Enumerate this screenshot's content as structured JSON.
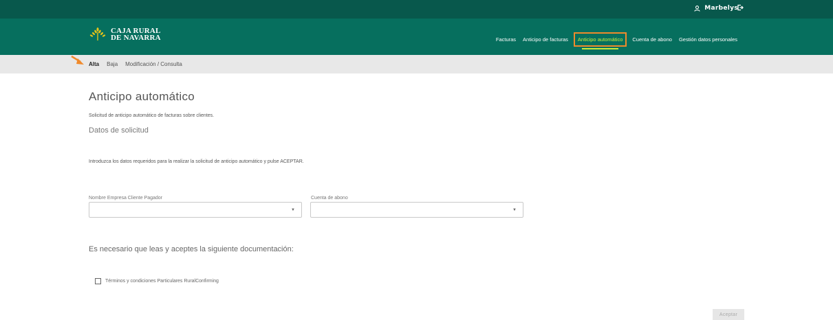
{
  "header": {
    "user_name": "Marbelys",
    "logo_line1": "CAJA RURAL",
    "logo_line2": "DE NAVARRA"
  },
  "nav": {
    "items": [
      {
        "label": "Facturas"
      },
      {
        "label": "Anticipo de facturas"
      },
      {
        "label": "Anticipo automático",
        "active": true
      },
      {
        "label": "Cuenta de abono"
      },
      {
        "label": "Gestión datos personales"
      }
    ]
  },
  "subnav": {
    "items": [
      {
        "label": "Alta",
        "active": true
      },
      {
        "label": "Baja"
      },
      {
        "label": "Modificación / Consulta"
      }
    ]
  },
  "page": {
    "title": "Anticipo automático",
    "intro": "Solicitud de anticipo automático de facturas sobre clientes.",
    "section_title": "Datos de solicitud",
    "instructions": "Introduzca los datos requeridos para la realizar la solicitud de anticipo automático y pulse ACEPTAR."
  },
  "form": {
    "company_label": "Nombre Empresa Cliente Pagador",
    "company_value": "",
    "account_label": "Cuenta de abono",
    "account_value": ""
  },
  "docs": {
    "heading": "Es necesario que leas y aceptes la siguiente documentación:",
    "terms_label": "Términos y condiciones Particulares RuralConfirming",
    "terms_checked": false
  },
  "actions": {
    "accept_label": "Aceptar"
  },
  "colors": {
    "header_dark": "#08584c",
    "header_main": "#066f5e",
    "accent_green": "#c9ec3c",
    "highlight_orange": "#f08a2b"
  }
}
